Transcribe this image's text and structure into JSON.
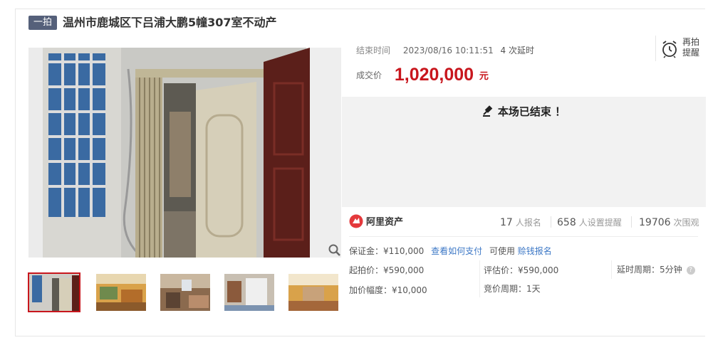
{
  "header": {
    "badge": "一拍",
    "title": "温州市鹿城区下吕浦大鹏5幢307室不动产"
  },
  "gallery": {
    "thumbnail_count": 5,
    "selected_index": 0
  },
  "auction": {
    "end_label": "结束时间",
    "end_time": "2023/08/16 10:11:51",
    "delay_count": "4 次延时",
    "price_label": "成交价",
    "price": "1,020,000",
    "unit": "元",
    "remind_line1": "再拍",
    "remind_line2": "提醒",
    "ended_message": "本场已结束 ！"
  },
  "stats": {
    "brand": "阿里资产",
    "signup_count": "17",
    "signup_label": "人报名",
    "remind_count": "658",
    "remind_label": "人设置提醒",
    "view_count": "19706",
    "view_label": "次围观"
  },
  "details": {
    "deposit": "保证金：¥110,000",
    "how_to_pay": "查看如何支付",
    "can_use": "可使用",
    "yuebao": "赊钱报名",
    "start_price": "起拍价：¥590,000",
    "increment": "加价幅度：¥10,000",
    "appraisal": "评估价：¥590,000",
    "bid_cycle": "竞价周期：1天",
    "delay_cycle": "延时周期：5分钟"
  },
  "colors": {
    "accent_red": "#c8161d",
    "badge_bg": "#55607a",
    "link_blue": "#3d78c6",
    "ended_bg": "#f2f2f2"
  }
}
